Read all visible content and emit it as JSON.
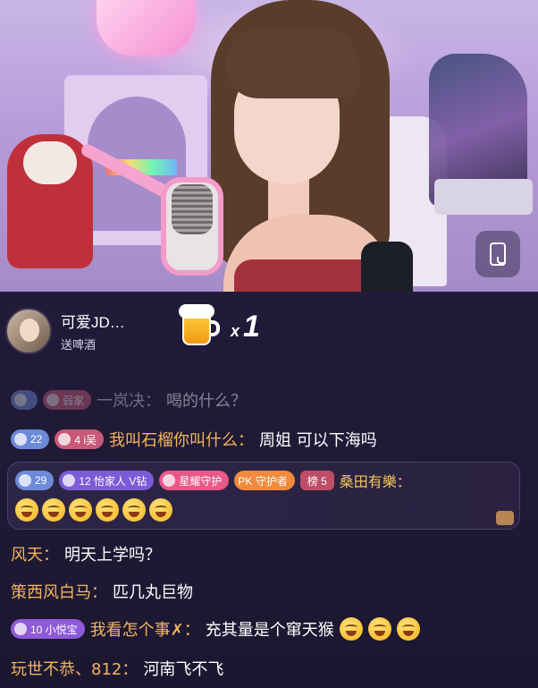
{
  "stream": {
    "rotate_button_icon": "rotate-screen-icon"
  },
  "gift": {
    "user": "可爱JD…",
    "action": "送啤酒",
    "icon": "beer-mug-icon",
    "count_prefix": "x",
    "count": "1"
  },
  "messages": [
    {
      "badges": [
        {
          "type": "level",
          "value": ""
        },
        {
          "type": "fan",
          "value": "弱家"
        }
      ],
      "name": "一岚决：",
      "text": "喝的什么？",
      "faded": true
    },
    {
      "badges": [
        {
          "type": "level",
          "value": "22"
        },
        {
          "type": "fan",
          "value": "4 i吴"
        }
      ],
      "name": "我叫石榴你叫什么：",
      "text": "周姐 可以下海吗"
    },
    {
      "badges": [
        {
          "type": "level",
          "value": "29"
        },
        {
          "type": "club",
          "value": "12 怡家人 V钻"
        },
        {
          "type": "guard",
          "value": "星耀守护"
        },
        {
          "type": "pk",
          "value": "PK 守护者"
        },
        {
          "type": "rank",
          "value": "榜 5"
        }
      ],
      "name": "桑田有樂：",
      "emojis": [
        "laugh-cry-emoji",
        "laugh-cry-emoji",
        "rofl-emoji",
        "rofl-emoji",
        "blush-emoji",
        "blush-emoji"
      ]
    },
    {
      "name": "风天：",
      "text": "明天上学吗？"
    },
    {
      "name": "策西风白马：",
      "text": "匹几丸巨物"
    },
    {
      "badges": [
        {
          "type": "fan",
          "value": "10 小悦宝"
        }
      ],
      "name": "我看怎个事✗：",
      "text": "充其量是个窜天猴",
      "emojis": [
        "laugh-cry-emoji",
        "laugh-cry-emoji",
        "laugh-cry-emoji"
      ]
    },
    {
      "name": "玩世不恭、812：",
      "text": "河南飞不飞"
    }
  ],
  "colors": {
    "chat_bg": "#1e1a33",
    "name_orange": "#f5b45e",
    "text_white": "#ffffff"
  }
}
